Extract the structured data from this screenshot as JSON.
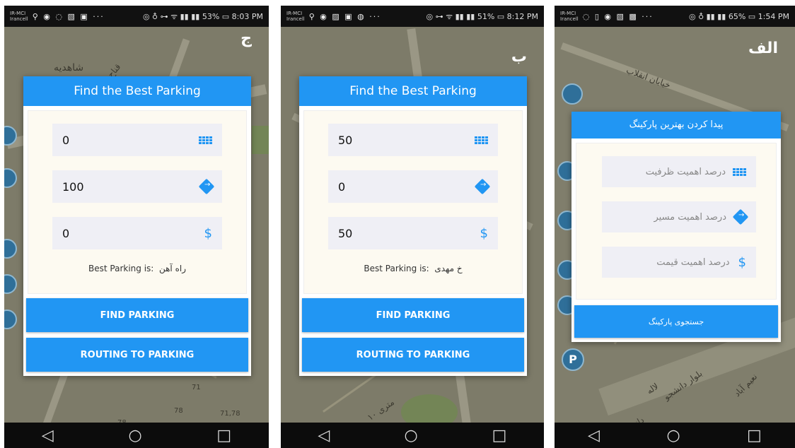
{
  "panels": [
    {
      "label": "ج",
      "status": {
        "carrier": "IR-MCI\nIrancell",
        "icons": "⚲ ◉ ◌ ▧ ▣ ···",
        "right": "◎ ♁ ⊶ ᯤ ▮▮ ▮▮ 53% ▭ 8:03 PM"
      },
      "map_text": [
        "شاهدیه",
        "قناح",
        "71",
        "78",
        "71,78",
        "78"
      ],
      "header": "Find the Best Parking",
      "fields": [
        {
          "value": "0",
          "icon": "grid-icon"
        },
        {
          "value": "100",
          "icon": "direction-icon"
        },
        {
          "value": "0",
          "icon": "dollar-icon"
        }
      ],
      "result_label": "Best Parking is:",
      "result_value": "راه آهن",
      "find_btn": "FIND PARKING",
      "route_btn": "ROUTING TO PARKING"
    },
    {
      "label": "ب",
      "status": {
        "carrier": "IR-MCI\nIrancell",
        "icons": "⚲ ◉ ▨ ▣ ◍ ···",
        "right": "◎ ⊶ ᯤ ▮▮ ▮▮ 51% ▭ 8:12 PM"
      },
      "map_text": [
        "۱۰ متری"
      ],
      "header": "Find the Best Parking",
      "fields": [
        {
          "value": "50",
          "icon": "grid-icon"
        },
        {
          "value": "0",
          "icon": "direction-icon"
        },
        {
          "value": "50",
          "icon": "dollar-icon"
        }
      ],
      "result_label": "Best Parking is:",
      "result_value": "خ مهدی",
      "find_btn": "FIND PARKING",
      "route_btn": "ROUTING TO PARKING"
    },
    {
      "label": "الف",
      "status": {
        "carrier": "IR-MCI\nIrancell",
        "icons": "◌ ▯ ◉ ▧ ▩ ···",
        "right": "◎ ♁ ▮▮ ▮▮ 65% ▭ 1:54 PM"
      },
      "map_text": [
        "خیابان انقلاب",
        "بلوار دانشجو",
        "لاله",
        "نعیم آباد",
        "دانش"
      ],
      "header": "پیدا کردن بهترین پارکینگ",
      "fields": [
        {
          "placeholder": "درصد اهمیت ظرفیت",
          "icon": "grid-icon"
        },
        {
          "placeholder": "درصد اهمیت مسیر",
          "icon": "direction-icon"
        },
        {
          "placeholder": "درصد اهمیت قیمت",
          "icon": "dollar-icon"
        }
      ],
      "search_btn": "جستجوی پارکینگ",
      "parking_marker": "P"
    }
  ],
  "nav": {
    "back": "◁",
    "home": "○",
    "recent": "□"
  },
  "colors": {
    "accent": "#2196f3",
    "map": "#7d7b69",
    "field_bg": "#efeff5"
  }
}
